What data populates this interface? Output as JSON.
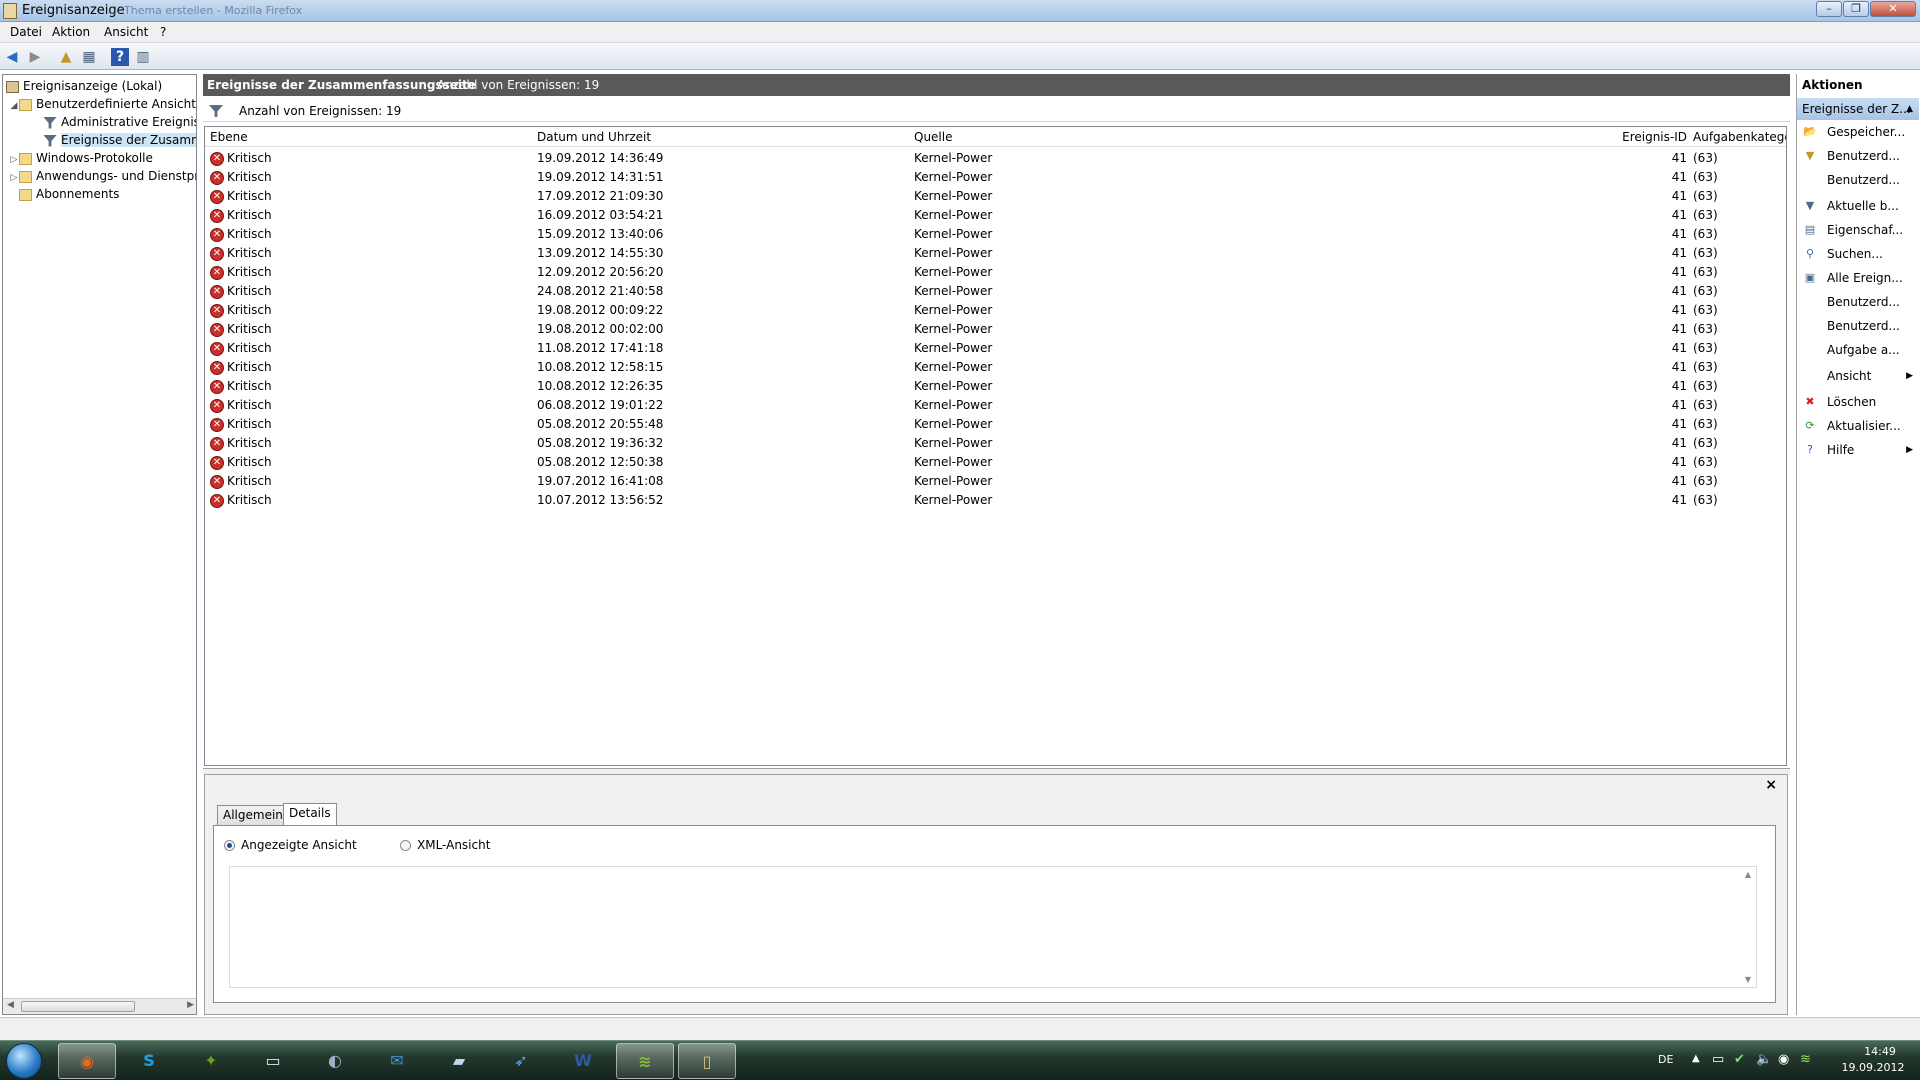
{
  "window": {
    "title": "Ereignisanzeige",
    "ghost_title": "... Thema erstellen - Mozilla Firefox"
  },
  "menu": [
    "Datei",
    "Aktion",
    "Ansicht",
    "?"
  ],
  "tree": {
    "items": [
      {
        "label": "Ereignisanzeige (Lokal)",
        "indent": 0,
        "icon": "computer-icon",
        "expander": ""
      },
      {
        "label": "Benutzerdefinierte Ansichten",
        "indent": 1,
        "icon": "folder-icon",
        "expander": "◢"
      },
      {
        "label": "Administrative Ereignisse",
        "indent": 2,
        "icon": "filter-icon",
        "expander": ""
      },
      {
        "label": "Ereignisse der Zusammenfassungsseite",
        "indent": 2,
        "icon": "filter-icon",
        "expander": "",
        "selected": true
      },
      {
        "label": "Windows-Protokolle",
        "indent": 1,
        "icon": "folder-icon",
        "expander": "▷"
      },
      {
        "label": "Anwendungs- und Dienstprotokolle",
        "indent": 1,
        "icon": "folder-icon",
        "expander": "▷"
      },
      {
        "label": "Abonnements",
        "indent": 1,
        "icon": "folder-icon",
        "expander": ""
      }
    ]
  },
  "main": {
    "header_title": "Ereignisse der Zusammenfassungsseite",
    "header_count": "Anzahl von Ereignissen: 19",
    "filter_text": "Anzahl von Ereignissen: 19",
    "columns": {
      "level": "Ebene",
      "datetime": "Datum und Uhrzeit",
      "source": "Quelle",
      "eventid": "Ereignis-ID",
      "category": "Aufgabenkategorie"
    },
    "rows": [
      {
        "level": "Kritisch",
        "datetime": "19.09.2012 14:36:49",
        "source": "Kernel-Power",
        "eventid": "41",
        "category": "(63)"
      },
      {
        "level": "Kritisch",
        "datetime": "19.09.2012 14:31:51",
        "source": "Kernel-Power",
        "eventid": "41",
        "category": "(63)"
      },
      {
        "level": "Kritisch",
        "datetime": "17.09.2012 21:09:30",
        "source": "Kernel-Power",
        "eventid": "41",
        "category": "(63)"
      },
      {
        "level": "Kritisch",
        "datetime": "16.09.2012 03:54:21",
        "source": "Kernel-Power",
        "eventid": "41",
        "category": "(63)"
      },
      {
        "level": "Kritisch",
        "datetime": "15.09.2012 13:40:06",
        "source": "Kernel-Power",
        "eventid": "41",
        "category": "(63)"
      },
      {
        "level": "Kritisch",
        "datetime": "13.09.2012 14:55:30",
        "source": "Kernel-Power",
        "eventid": "41",
        "category": "(63)"
      },
      {
        "level": "Kritisch",
        "datetime": "12.09.2012 20:56:20",
        "source": "Kernel-Power",
        "eventid": "41",
        "category": "(63)"
      },
      {
        "level": "Kritisch",
        "datetime": "24.08.2012 21:40:58",
        "source": "Kernel-Power",
        "eventid": "41",
        "category": "(63)"
      },
      {
        "level": "Kritisch",
        "datetime": "19.08.2012 00:09:22",
        "source": "Kernel-Power",
        "eventid": "41",
        "category": "(63)"
      },
      {
        "level": "Kritisch",
        "datetime": "19.08.2012 00:02:00",
        "source": "Kernel-Power",
        "eventid": "41",
        "category": "(63)"
      },
      {
        "level": "Kritisch",
        "datetime": "11.08.2012 17:41:18",
        "source": "Kernel-Power",
        "eventid": "41",
        "category": "(63)"
      },
      {
        "level": "Kritisch",
        "datetime": "10.08.2012 12:58:15",
        "source": "Kernel-Power",
        "eventid": "41",
        "category": "(63)"
      },
      {
        "level": "Kritisch",
        "datetime": "10.08.2012 12:26:35",
        "source": "Kernel-Power",
        "eventid": "41",
        "category": "(63)"
      },
      {
        "level": "Kritisch",
        "datetime": "06.08.2012 19:01:22",
        "source": "Kernel-Power",
        "eventid": "41",
        "category": "(63)"
      },
      {
        "level": "Kritisch",
        "datetime": "05.08.2012 20:55:48",
        "source": "Kernel-Power",
        "eventid": "41",
        "category": "(63)"
      },
      {
        "level": "Kritisch",
        "datetime": "05.08.2012 19:36:32",
        "source": "Kernel-Power",
        "eventid": "41",
        "category": "(63)"
      },
      {
        "level": "Kritisch",
        "datetime": "05.08.2012 12:50:38",
        "source": "Kernel-Power",
        "eventid": "41",
        "category": "(63)"
      },
      {
        "level": "Kritisch",
        "datetime": "19.07.2012 16:41:08",
        "source": "Kernel-Power",
        "eventid": "41",
        "category": "(63)"
      },
      {
        "level": "Kritisch",
        "datetime": "10.07.2012 13:56:52",
        "source": "Kernel-Power",
        "eventid": "41",
        "category": "(63)"
      }
    ]
  },
  "detail": {
    "close": "×",
    "tabs": [
      "Allgemein",
      "Details"
    ],
    "radio_friendly": "Angezeigte Ansicht",
    "radio_xml": "XML-Ansicht"
  },
  "actions": {
    "header": "Aktionen",
    "section": "Ereignisse der Z...",
    "items": [
      {
        "label": "Gespeicher...",
        "icon": "open-folder-icon",
        "glyph": "📂"
      },
      {
        "label": "Benutzerd...",
        "icon": "filter-add-icon",
        "glyph": "▼"
      },
      {
        "label": "Benutzerd...",
        "icon": "",
        "glyph": ""
      },
      {
        "label": "Aktuelle b...",
        "icon": "filter-icon",
        "glyph": "▼"
      },
      {
        "label": "Eigenschaf...",
        "icon": "properties-icon",
        "glyph": "▤"
      },
      {
        "label": "Suchen...",
        "icon": "binoculars-icon",
        "glyph": "⚲"
      },
      {
        "label": "Alle Ereign...",
        "icon": "save-icon",
        "glyph": "▣"
      },
      {
        "label": "Benutzerd...",
        "icon": "",
        "glyph": ""
      },
      {
        "label": "Benutzerd...",
        "icon": "",
        "glyph": ""
      },
      {
        "label": "Aufgabe a...",
        "icon": "",
        "glyph": ""
      },
      {
        "label": "Ansicht",
        "icon": "",
        "glyph": "",
        "submenu": true
      },
      {
        "label": "Löschen",
        "icon": "delete-icon",
        "glyph": "✖"
      },
      {
        "label": "Aktualisier...",
        "icon": "refresh-icon",
        "glyph": "⟳"
      },
      {
        "label": "Hilfe",
        "icon": "help-icon",
        "glyph": "?",
        "submenu": true
      }
    ]
  },
  "taskbar": {
    "apps": [
      {
        "name": "firefox",
        "glyph": "◉",
        "color": "#e66a1f"
      },
      {
        "name": "skype",
        "glyph": "S",
        "color": "#1da1e8"
      },
      {
        "name": "app-green",
        "glyph": "✦",
        "color": "#6b9f2a"
      },
      {
        "name": "remote-desktop",
        "glyph": "▭",
        "color": "#dfe6ef"
      },
      {
        "name": "steam-like",
        "glyph": "◐",
        "color": "#9fb0c0"
      },
      {
        "name": "thunderbird",
        "glyph": "✉",
        "color": "#4a8fd0"
      },
      {
        "name": "notes",
        "glyph": "▰",
        "color": "#bcd8ea"
      },
      {
        "name": "rocket",
        "glyph": "➶",
        "color": "#5fa8e8"
      },
      {
        "name": "word",
        "glyph": "W",
        "color": "#2b5aa8"
      },
      {
        "name": "spotify",
        "glyph": "≋",
        "color": "#7fbf2f"
      },
      {
        "name": "event-viewer",
        "glyph": "▯",
        "color": "#d8c27a"
      }
    ],
    "lang": "DE",
    "time": "14:49",
    "date": "19.09.2012"
  },
  "colors": {
    "header_bar": "#595959",
    "critical": "#c8302b",
    "selection": "#cde6f7"
  }
}
